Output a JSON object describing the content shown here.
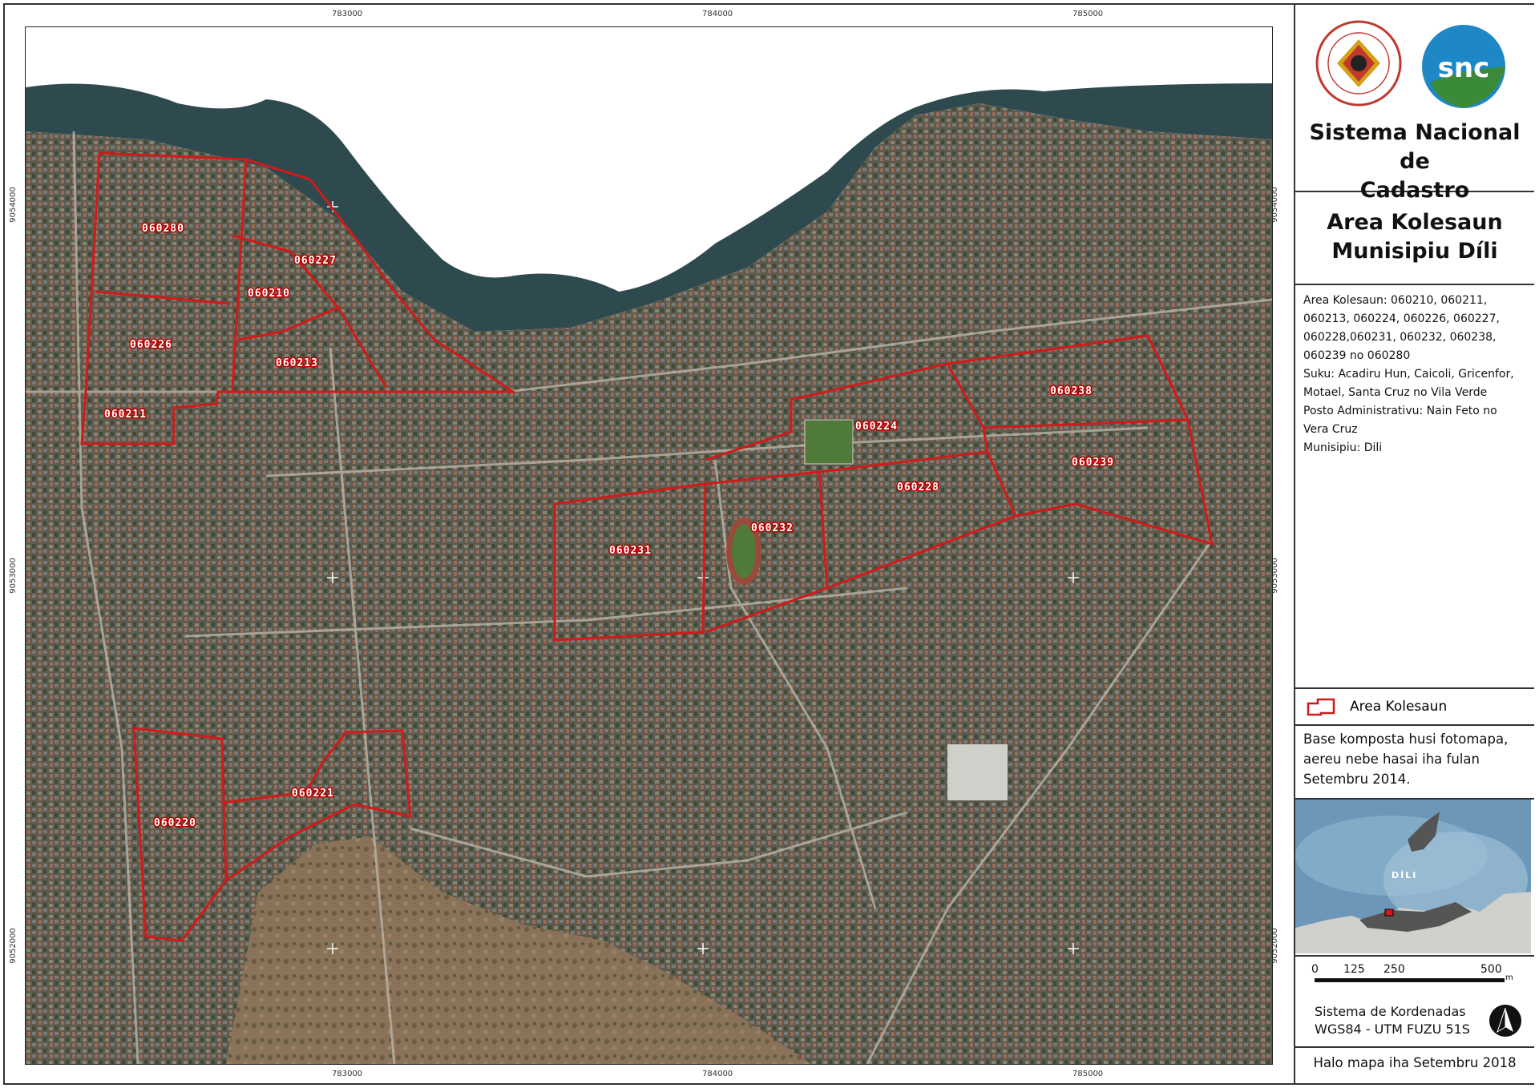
{
  "map": {
    "grid_x_labels": [
      "783000",
      "784000",
      "785000"
    ],
    "grid_y_labels": [
      "9054000",
      "9053000",
      "9052000"
    ],
    "zone_labels": [
      "060280",
      "060227",
      "060210",
      "060226",
      "060213",
      "060211",
      "060224",
      "060238",
      "060239",
      "060228",
      "060232",
      "060231",
      "060221",
      "060220"
    ],
    "boundary_color": "#d11a1a"
  },
  "header": {
    "title_line1": "Sistema Nacional de",
    "title_line2": "Cadastro",
    "logo_left": "RDTL seal",
    "logo_right": "snc"
  },
  "area_title": {
    "line1": "Area Kolesaun",
    "line2": "Munisipiu Díli"
  },
  "description": {
    "line1": "Area Kolesaun: 060210, 060211,",
    "line2": "060213, 060224, 060226, 060227,",
    "line3": "060228,060231, 060232, 060238,",
    "line4": "060239  no 060280",
    "line5": "Suku: Acadiru Hun, Caicoli, Gricenfor,",
    "line6": "Motael, Santa Cruz no Vila Verde",
    "line7": "Posto Administrativu: Nain Feto no",
    "line8": "Vera Cruz",
    "line9": "Munisipiu: Dili"
  },
  "legend": {
    "item": "Area Kolesaun"
  },
  "source": {
    "line1": "Base komposta husi fotomapa,",
    "line2": "aereu nebe hasai iha fulan",
    "line3": "Setembru 2014."
  },
  "inset": {
    "label": "DÍLI"
  },
  "scale": {
    "ticks": [
      "0",
      "125",
      "250",
      "500"
    ],
    "unit": "m"
  },
  "crs": {
    "line1": "Sistema de Kordenadas",
    "line2": "WGS84 - UTM FUZU 51S"
  },
  "footer": {
    "text": "Halo mapa iha Setembru 2018"
  }
}
